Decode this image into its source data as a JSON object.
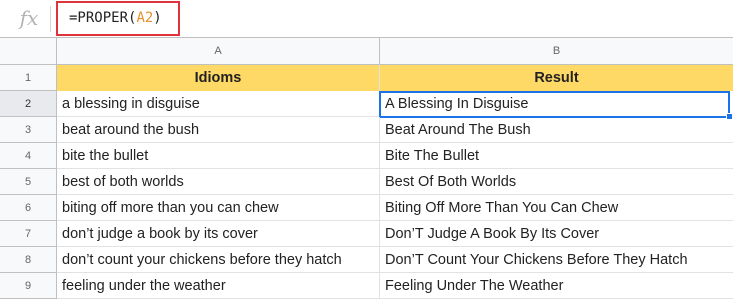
{
  "formula_bar": {
    "fx_icon": "fx",
    "prefix": "=PROPER(",
    "ref": "A2",
    "suffix": ")"
  },
  "columns": [
    "A",
    "B"
  ],
  "header": {
    "row": "1",
    "a": "Idioms",
    "b": "Result"
  },
  "rows": [
    {
      "num": "2",
      "a": "a blessing in disguise",
      "b": "A Blessing In Disguise"
    },
    {
      "num": "3",
      "a": "beat around the bush",
      "b": "Beat Around The Bush"
    },
    {
      "num": "4",
      "a": "bite the bullet",
      "b": "Bite The Bullet"
    },
    {
      "num": "5",
      "a": "best of both worlds",
      "b": "Best Of Both Worlds"
    },
    {
      "num": "6",
      "a": "biting off more than you can chew",
      "b": "Biting Off More Than You Can Chew"
    },
    {
      "num": "7",
      "a": "don’t judge a book by its cover",
      "b": "Don’T Judge A Book By Its Cover"
    },
    {
      "num": "8",
      "a": "don’t count your chickens before they hatch",
      "b": "Don’T Count Your Chickens Before They Hatch"
    },
    {
      "num": "9",
      "a": "feeling under the weather",
      "b": "Feeling Under The Weather"
    }
  ],
  "colors": {
    "header_fill": "#ffd966",
    "formula_highlight": "#e0343c",
    "selection": "#1a73e8"
  }
}
